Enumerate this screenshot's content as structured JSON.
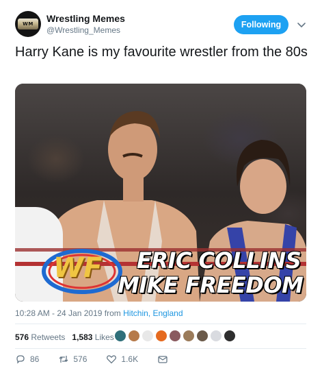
{
  "author": {
    "display_name": "Wrestling Memes",
    "handle": "@Wrestling_Memes",
    "avatar_text": "WM"
  },
  "follow_label": "Following",
  "tweet_text": "Harry Kane is my favourite wrestler from the 80s",
  "media": {
    "caption_line1": "ERIC COLLINS",
    "caption_line2": "MIKE FREEDOM",
    "logo_text": "WF"
  },
  "meta": {
    "time_date": "10:28 AM - 24 Jan 2019 from",
    "location": "Hitchin, England"
  },
  "stats": {
    "retweets_count": "576",
    "retweets_label": "Retweets",
    "likes_count": "1,583",
    "likes_label": "Likes"
  },
  "likers": [
    {
      "color": "#2f6f7a"
    },
    {
      "color": "#b67a4a"
    },
    {
      "color": "#e8e8e8"
    },
    {
      "color": "#e56a1f"
    },
    {
      "color": "#8a5a5f"
    },
    {
      "color": "#9b7b5a"
    },
    {
      "color": "#6b5a4a"
    },
    {
      "color": "#d9dbe0"
    },
    {
      "color": "#2e2e2e"
    }
  ],
  "actions": {
    "replies": "86",
    "retweets": "576",
    "likes": "1.6K"
  },
  "icons": [
    "reply-icon",
    "retweet-icon",
    "like-icon",
    "message-icon",
    "chevron-down-icon"
  ],
  "colors": {
    "accent": "#1da1f2",
    "link": "#1b95e0",
    "muted": "#657786"
  }
}
